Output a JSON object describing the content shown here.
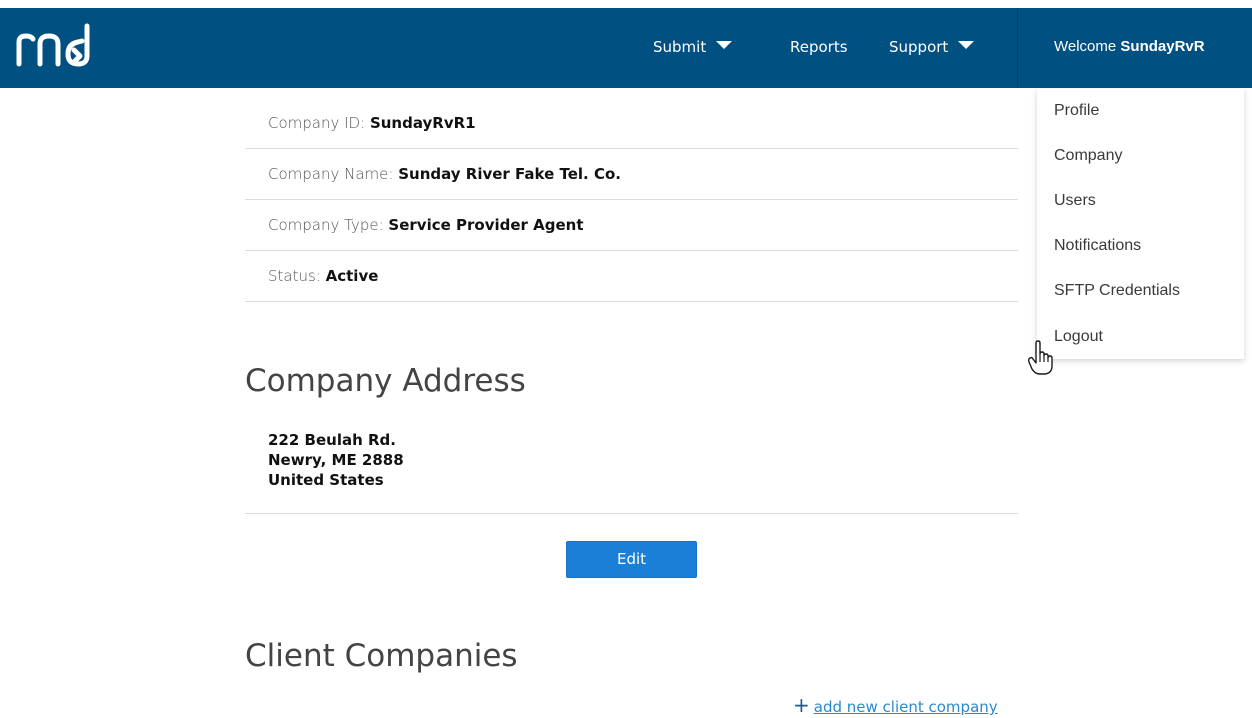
{
  "brand": {
    "logo_text": "rnd",
    "colors": {
      "navbar": "#005082",
      "primary_button": "#1a7fd6",
      "link": "#2a8ad0"
    }
  },
  "nav": {
    "items": [
      {
        "label": "Submit",
        "has_dropdown": true,
        "icon": "caret-down-icon"
      },
      {
        "label": "Reports",
        "has_dropdown": false
      },
      {
        "label": "Support",
        "has_dropdown": true,
        "icon": "caret-down-icon"
      }
    ],
    "welcome_prefix": "Welcome",
    "username": "SundayRvR"
  },
  "user_menu": {
    "items": [
      {
        "label": "Profile"
      },
      {
        "label": "Company"
      },
      {
        "label": "Users"
      },
      {
        "label": "Notifications"
      },
      {
        "label": "SFTP Credentials"
      },
      {
        "label": "Logout"
      }
    ]
  },
  "company": {
    "rows": [
      {
        "label": "Company ID:",
        "value": "SundayRvR1"
      },
      {
        "label": "Company Name:",
        "value": "Sunday River Fake Tel. Co."
      },
      {
        "label": "Company Type:",
        "value": "Service Provider Agent"
      },
      {
        "label": "Status:",
        "value": "Active"
      }
    ]
  },
  "address_section": {
    "title": "Company Address",
    "lines": [
      "222 Beulah Rd.",
      "Newry, ME 2888",
      "United States"
    ],
    "edit_label": "Edit"
  },
  "clients_section": {
    "title": "Client Companies",
    "add_icon": "plus-icon",
    "add_symbol": "+",
    "add_label": "add new client company"
  }
}
